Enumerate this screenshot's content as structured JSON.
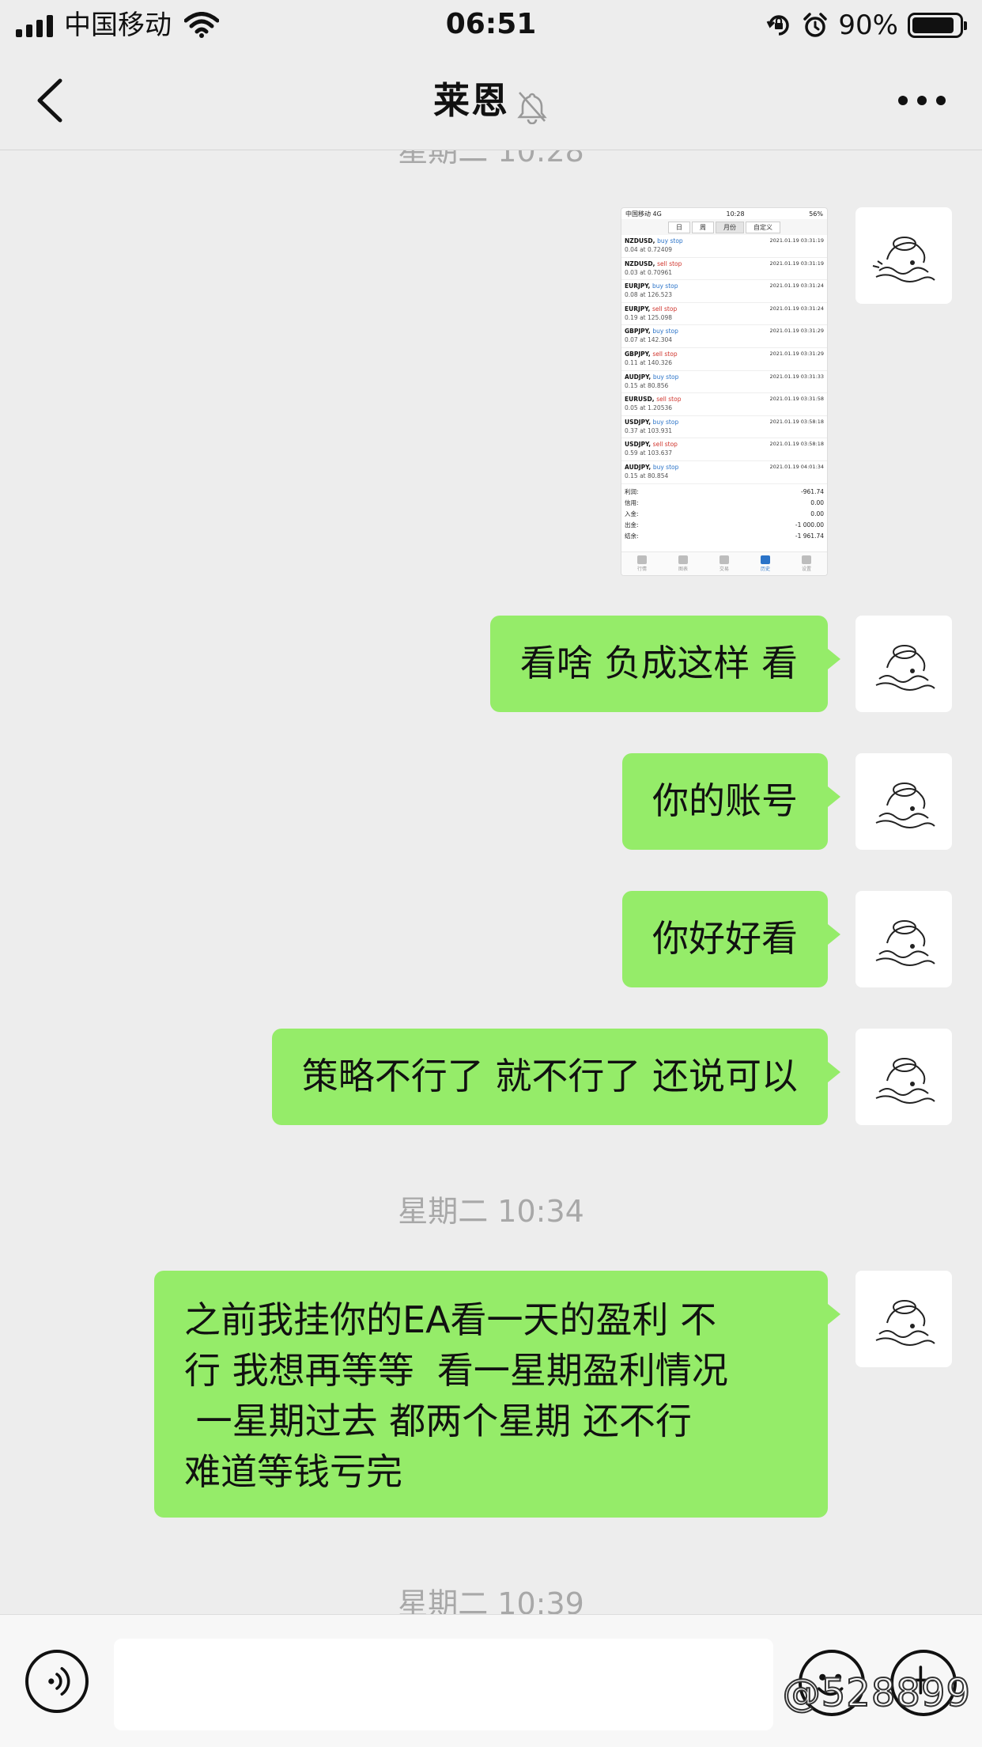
{
  "status_bar": {
    "carrier": "中国移动",
    "time": "06:51",
    "battery_percent": "90%",
    "battery_level": 0.9
  },
  "nav": {
    "title": "莱恩",
    "muted": true
  },
  "chat": {
    "partial_timestamp": "星期二 10:28",
    "image_message": {
      "status_carrier": "中国移动 4G",
      "status_time": "10:28",
      "status_battery": "56%",
      "segments": [
        "日",
        "周",
        "月份",
        "自定义"
      ],
      "selected_segment": "月份",
      "orders": [
        {
          "symbol": "NZDUSD,",
          "type": "buy stop",
          "detail": "0.04 at 0.72409",
          "time": "2021.01.19 03:31:19"
        },
        {
          "symbol": "NZDUSD,",
          "type": "sell stop",
          "detail": "0.03 at 0.70961",
          "time": "2021.01.19 03:31:19"
        },
        {
          "symbol": "EURJPY,",
          "type": "buy stop",
          "detail": "0.08 at 126.523",
          "time": "2021.01.19 03:31:24"
        },
        {
          "symbol": "EURJPY,",
          "type": "sell stop",
          "detail": "0.19 at 125.098",
          "time": "2021.01.19 03:31:24"
        },
        {
          "symbol": "GBPJPY,",
          "type": "buy stop",
          "detail": "0.07 at 142.304",
          "time": "2021.01.19 03:31:29"
        },
        {
          "symbol": "GBPJPY,",
          "type": "sell stop",
          "detail": "0.11 at 140.326",
          "time": "2021.01.19 03:31:29"
        },
        {
          "symbol": "AUDJPY,",
          "type": "buy stop",
          "detail": "0.15 at 80.856",
          "time": "2021.01.19 03:31:33"
        },
        {
          "symbol": "EURUSD,",
          "type": "sell stop",
          "detail": "0.05 at 1.20536",
          "time": "2021.01.19 03:31:58"
        },
        {
          "symbol": "USDJPY,",
          "type": "buy stop",
          "detail": "0.37 at 103.931",
          "time": "2021.01.19 03:58:18"
        },
        {
          "symbol": "USDJPY,",
          "type": "sell stop",
          "detail": "0.59 at 103.637",
          "time": "2021.01.19 03:58:18"
        },
        {
          "symbol": "AUDJPY,",
          "type": "buy stop",
          "detail": "0.15 at 80.854",
          "time": "2021.01.19 04:01:34"
        }
      ],
      "summary": [
        {
          "label": "利润:",
          "value": "-961.74"
        },
        {
          "label": "信用:",
          "value": "0.00"
        },
        {
          "label": "入金:",
          "value": "0.00"
        },
        {
          "label": "出金:",
          "value": "-1 000.00"
        },
        {
          "label": "结余:",
          "value": "-1 961.74"
        }
      ],
      "tabs": [
        "行情",
        "图表",
        "交易",
        "历史",
        "设置"
      ],
      "active_tab": "历史"
    },
    "messages": [
      {
        "text": "看啥 负成这样 看"
      },
      {
        "text": "你的账号"
      },
      {
        "text": "你好好看"
      },
      {
        "text": "策略不行了 就不行了 还说可以"
      }
    ],
    "timestamp_1": "星期二 10:34",
    "long_message": "之前我挂你的EA看一天的盈利 不\n行 我想再等等  看一星期盈利情况\n 一星期过去 都两个星期 还不行\n难道等钱亏完",
    "timestamp_2": "星期二 10:39"
  },
  "input_bar": {
    "placeholder": "",
    "value": ""
  },
  "watermark": "@528899",
  "colors": {
    "bubble": "#95ec69",
    "background": "#ededed"
  }
}
